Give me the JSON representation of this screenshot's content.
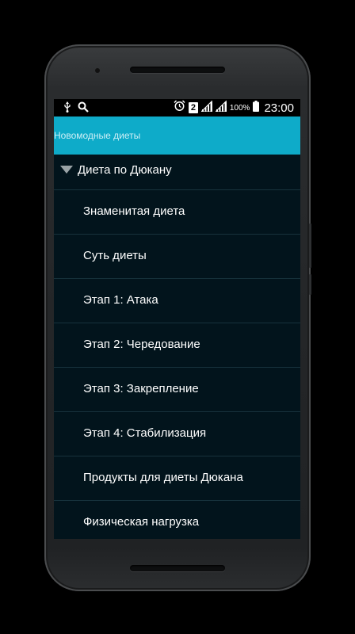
{
  "status_bar": {
    "icons_left": [
      "usb-icon",
      "search-icon"
    ],
    "icons_right": [
      "alarm-icon",
      "sim-2-icon",
      "signal-icon",
      "signal-icon"
    ],
    "sim_number": "2",
    "battery": "100%",
    "time": "23:00"
  },
  "app_bar": {
    "title": "Новомодные диеты",
    "color": "#0eabc9"
  },
  "list": {
    "group": {
      "label": "Диета по Дюкану",
      "icon": "triangle-down-icon",
      "expanded": true
    },
    "items": [
      {
        "label": "Знаменитая диета"
      },
      {
        "label": "Суть диеты"
      },
      {
        "label": "Этап 1: Атака"
      },
      {
        "label": "Этап 2: Чередование"
      },
      {
        "label": "Этап 3: Закрепление"
      },
      {
        "label": "Этап 4: Стабилизация"
      },
      {
        "label": "Продукты для диеты Дюкана"
      },
      {
        "label": "Физическая нагрузка"
      }
    ]
  },
  "colors": {
    "background": "#02141c",
    "divider": "#17323c",
    "status_bar": "#000000"
  }
}
